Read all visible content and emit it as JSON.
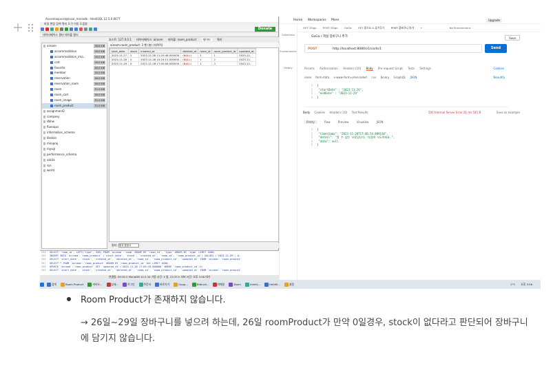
{
  "editor": {
    "plus_icon": "plus-icon",
    "drag_icon": "drag-handle-icon"
  },
  "heidi": {
    "title": "Ascomlaquvist@local_mariadb - HeidiSQL 12.5.0.6677",
    "menu": "파일 편집 검색 쿼리 도구 이동 도움말",
    "donate": "Donate",
    "filter": "데이터베이스 필터   테이블 필터",
    "tabs": [
      "호스트: 127.0.0.1",
      "데이터베이스: airoom",
      "테이블: room_product",
      "데이터",
      "쿼리"
    ],
    "grid_info": "airoom.room_product: 3 행 (총) (대략적)",
    "tree": [
      {
        "label": "airoom",
        "size": "38.6 KiB",
        "type": "db"
      },
      {
        "label": "accommodation",
        "size": "16.0 KiB",
        "type": "table"
      },
      {
        "label": "accommodation_ima...",
        "size": "16.0 KiB",
        "type": "table"
      },
      {
        "label": "cart",
        "size": "16.0 KiB",
        "type": "table"
      },
      {
        "label": "favorite",
        "size": "48.0 KiB",
        "type": "table"
      },
      {
        "label": "member",
        "size": "16.0 KiB",
        "type": "table"
      },
      {
        "label": "reservation",
        "size": "48.0 KiB",
        "type": "table"
      },
      {
        "label": "reservation_room",
        "size": "48.0 KiB",
        "type": "table"
      },
      {
        "label": "room",
        "size": "32.0 KiB",
        "type": "table"
      },
      {
        "label": "room_cart",
        "size": "48.0 KiB",
        "type": "table"
      },
      {
        "label": "room_image",
        "size": "32.0 KiB",
        "type": "table"
      },
      {
        "label": "room_product",
        "size": "32.0 KiB",
        "type": "table"
      },
      {
        "label": "assignment2",
        "size": "",
        "type": "db"
      },
      {
        "label": "company",
        "size": "",
        "type": "db"
      },
      {
        "label": "dbhw",
        "size": "",
        "type": "db"
      },
      {
        "label": "fluenqus",
        "size": "",
        "type": "db"
      },
      {
        "label": "information_schema",
        "size": "",
        "type": "db"
      },
      {
        "label": "likelion",
        "size": "",
        "type": "db"
      },
      {
        "label": "miniproj",
        "size": "",
        "type": "db"
      },
      {
        "label": "mysql",
        "size": "",
        "type": "db"
      },
      {
        "label": "performance_schema",
        "size": "",
        "type": "db"
      },
      {
        "label": "sakila",
        "size": "",
        "type": "db"
      },
      {
        "label": "sys",
        "size": "",
        "type": "db"
      },
      {
        "label": "world",
        "size": "",
        "type": "db"
      }
    ],
    "columns": [
      "start_date",
      "stock",
      "created_at",
      "deleted_at",
      "room_id",
      "room_product_id",
      "updated_at"
    ],
    "rows": [
      [
        "2023-11-27",
        "2",
        "2023-11-28 11:20:46.000000",
        "(NULL)",
        "1",
        "1",
        "2023-11-"
      ],
      [
        "2023-11-28",
        "0",
        "2023-11-28 10:24:21.000000",
        "(NULL)",
        "1",
        "2",
        "2023-11-"
      ],
      [
        "2023-11-29",
        "0",
        "2023-11-28 17:05:06.000000",
        "(NULL)",
        "1",
        "3",
        "2023-11-"
      ]
    ],
    "filter_label": "필터:",
    "filter_placeholder": "정규 표현식",
    "log": [
      [
        "254",
        "SELECT `room_id`, LEFT(`type`, 256) FROM `airoom`.`room` GROUP BY `room_id`, `type` ORDER BY `type` LIMIT 1000;"
      ],
      [
        "255",
        "INSERT INTO `airoom`.`room_product` (`start_date`, `stock`, `created_at`, `room_id`, `room_product_id`) VALUES ('2023-11-29', 0,"
      ],
      [
        "256",
        "SELECT `start_date`, `stock`, `created_at`, `deleted_at`, `room_id`, `room_product_id`, `updated_at` FROM `airoom`.`room_product`"
      ],
      [
        "257",
        "SELECT * FROM `airoom`.`room_product` ORDER BY `room_product_id` ASC LIMIT 1000;"
      ],
      [
        "258",
        "UPDATE `airoom`.`room_product` SET `updated_at`='2023-11-28 17:05:43.000000' WHERE `room_product_id`=3;"
      ],
      [
        "259",
        "SELECT `start_date`, `stock`, `created_at`, `deleted_at`, `room_id`, `room_product_id`, `updated_at` FROM `airoom`.`room_product`"
      ]
    ],
    "status": "연결됨: 00:30 h   MariaDB 10.5.34   가동 시간: 4 일, 22:33 h   서버 시간: 오후 3:56   대기"
  },
  "postman": {
    "nav": [
      "Home",
      "Workspaces",
      "More"
    ],
    "upgrade": "Upgrade",
    "side": [
      "Collections",
      "Environments",
      "History"
    ],
    "tabs": [
      "GET 2Sign",
      "POST 2Sign",
      "GoGo",
      "GET 좋아요 & 즐겨찾기",
      "POST 장바구니 추가",
      "+",
      "No Environment"
    ],
    "path": "GoGo / 객실 장바구니 추가",
    "save": "Save",
    "method": "POST",
    "url": "http://localhost:8080/v1/carts/1",
    "send": "Send",
    "req_tabs": [
      "Params",
      "Authorization",
      "Headers (10)",
      "Body",
      "Pre-request Script",
      "Tests",
      "Settings"
    ],
    "cookies": "Cookies",
    "body_opts": [
      "none",
      "form-data",
      "x-www-form-urlencoded",
      "raw",
      "binary",
      "GraphQL",
      "JSON"
    ],
    "beautify": "Beautify",
    "req_body": [
      [
        "1",
        "{"
      ],
      [
        "2",
        "    \"startDate\" : \"2023-11-26\","
      ],
      [
        "3",
        "    \"endDate\" : \"2023-11-29\""
      ],
      [
        "4",
        "}"
      ]
    ],
    "resp_tabs": [
      "Body",
      "Cookies",
      "Headers (10)",
      "Test Results"
    ],
    "resp_status": "500 Internal Server Error   21 ms   541 B",
    "save_example": "Save as example",
    "resp_view": [
      "Pretty",
      "Raw",
      "Preview",
      "Visualize",
      "JSON"
    ],
    "resp_body": [
      [
        "1",
        "{"
      ],
      [
        "2",
        "    \"timestamp\": \"2023-11-28T17:46:54.889138\","
      ],
      [
        "3",
        "    \"detail\": \"알 수 없는 오류입니다. 다음에 시도하세요.\","
      ],
      [
        "4",
        "    \"data\": null"
      ],
      [
        "5",
        "}"
      ]
    ]
  },
  "taskbar": {
    "apps": [
      "검색",
      "Room Product",
      "카카오...",
      "상세...",
      "로그인",
      "주문서",
      "바로가기",
      "Gupp...",
      "Bitbuck..",
      "이메일",
      "Zoom",
      "Intellij...",
      "HeidiS...",
      "설정"
    ],
    "weather": "2°C",
    "clock": "오후 3:56"
  },
  "doc": {
    "bullet_text": "Room Product가 존재하지 않습니다.",
    "paragraph": "→ 26일~29일 장바구니를 넣으려 하는데, 26일 roomProduct가 만약 0일경우, stock이 없다라고 판단되어 장바구니에 담기지 않습니다."
  }
}
